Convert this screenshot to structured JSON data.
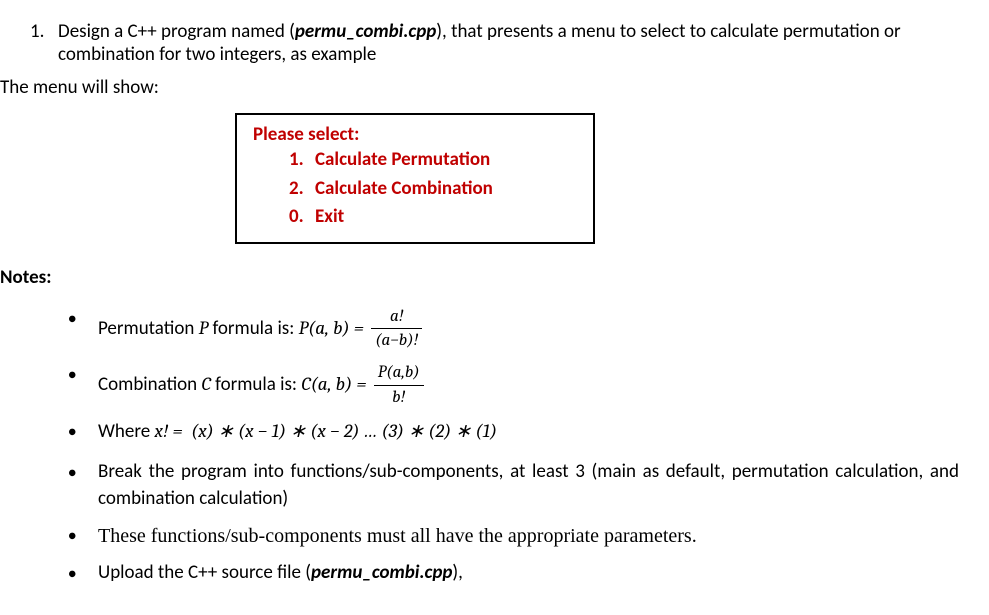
{
  "question": {
    "number": "1.",
    "text_before_filename": "Design a C++ program named (",
    "filename": "permu_combi.cpp",
    "text_after_filename": "), that presents a menu to select to calculate permutation or combination for two integers, as example"
  },
  "menu_intro": "The menu will show:",
  "menu": {
    "header": "Please select:",
    "items": [
      {
        "num": "1.",
        "label": "Calculate Permutation"
      },
      {
        "num": "2.",
        "label": "Calculate Combination"
      },
      {
        "num": "0.",
        "label": "Exit"
      }
    ]
  },
  "notes_header": "Notes:",
  "bullets": {
    "perm": {
      "label_prefix": "Permutation ",
      "var": "P",
      "label_mid": " formula is: ",
      "func": "P(a, b) =",
      "frac_num": "a!",
      "frac_den": "(a−b)!"
    },
    "comb": {
      "label_prefix": "Combination ",
      "var": "C",
      "label_mid": " formula is: ",
      "func": "C(a, b) =",
      "frac_num": "P(a,b)",
      "frac_den": "b!"
    },
    "factorial": {
      "prefix": "Where ",
      "lhs": "x! =",
      "rhs": "(x) ∗ (x − 1) ∗ (x − 2) … (3) ∗ (2) ∗ (1)"
    },
    "break_program": "Break the program into functions/sub-components, at least 3 (main as default, permutation calculation, and combination calculation)",
    "parameters": "These functions/sub-components must all have the appropriate parameters.",
    "upload": {
      "prefix": "Upload the C++ source file (",
      "filename": "permu_combi.cpp",
      "suffix": "),"
    }
  }
}
